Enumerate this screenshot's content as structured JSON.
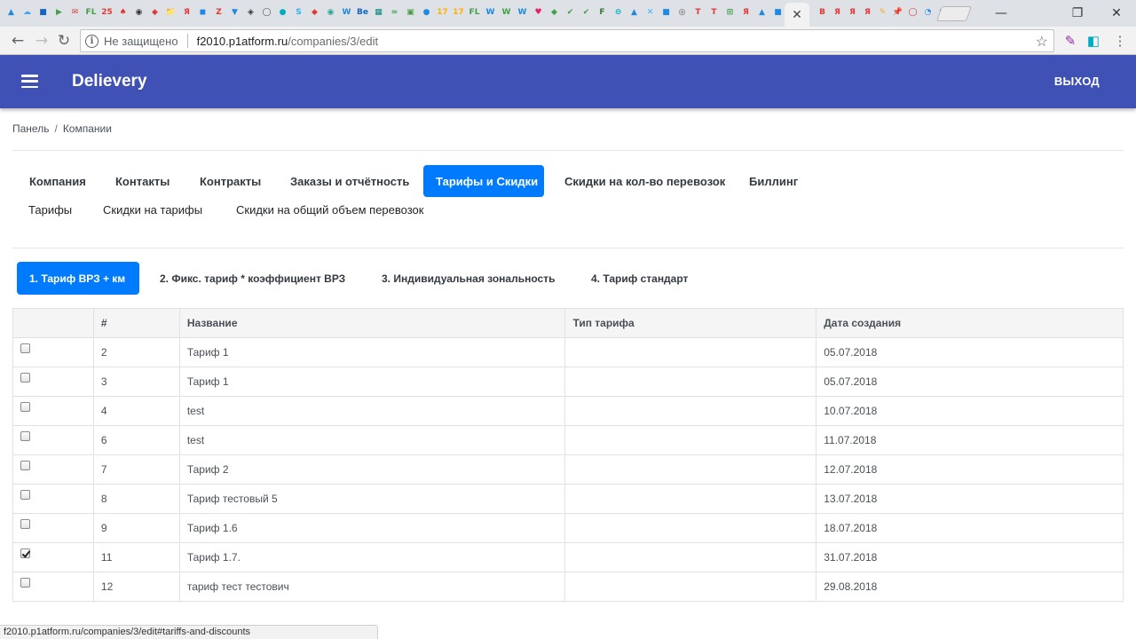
{
  "browser": {
    "tab_icons": [
      {
        "glyph": "▲",
        "color": "#1e88e5"
      },
      {
        "glyph": "☁",
        "color": "#42a5f5"
      },
      {
        "glyph": "■",
        "color": "#1565c0"
      },
      {
        "glyph": "▶",
        "color": "#43a047"
      },
      {
        "glyph": "✉",
        "color": "#e53935"
      },
      {
        "glyph": "FL",
        "color": "#43a047"
      },
      {
        "glyph": "25",
        "color": "#e53935"
      },
      {
        "glyph": "♠",
        "color": "#e53935"
      },
      {
        "glyph": "◉",
        "color": "#333333"
      },
      {
        "glyph": "◆",
        "color": "#e53935"
      },
      {
        "glyph": "📁",
        "color": "#f9a825"
      },
      {
        "glyph": "Я",
        "color": "#e53935"
      },
      {
        "glyph": "◼",
        "color": "#1e88e5"
      },
      {
        "glyph": "Z",
        "color": "#e53935"
      },
      {
        "glyph": "▼",
        "color": "#1e88e5"
      },
      {
        "glyph": "◈",
        "color": "#333333"
      },
      {
        "glyph": "◯",
        "color": "#555555"
      },
      {
        "glyph": "●",
        "color": "#00acc1"
      },
      {
        "glyph": "S",
        "color": "#29b6f6"
      },
      {
        "glyph": "◆",
        "color": "#e53935"
      },
      {
        "glyph": "◉",
        "color": "#26a69a"
      },
      {
        "glyph": "W",
        "color": "#1e88e5"
      },
      {
        "glyph": "Be",
        "color": "#1565c0"
      },
      {
        "glyph": "▦",
        "color": "#00897b"
      },
      {
        "glyph": "∞",
        "color": "#43a047"
      },
      {
        "glyph": "▣",
        "color": "#43a047"
      },
      {
        "glyph": "●",
        "color": "#1e88e5"
      },
      {
        "glyph": "17",
        "color": "#ffb300"
      },
      {
        "glyph": "17",
        "color": "#ffb300"
      },
      {
        "glyph": "FL",
        "color": "#43a047"
      },
      {
        "glyph": "W",
        "color": "#1e88e5"
      },
      {
        "glyph": "W",
        "color": "#43a047"
      },
      {
        "glyph": "W",
        "color": "#1e88e5"
      },
      {
        "glyph": "♥",
        "color": "#e91e63"
      },
      {
        "glyph": "◆",
        "color": "#43a047"
      },
      {
        "glyph": "✔",
        "color": "#43a047"
      },
      {
        "glyph": "✔",
        "color": "#43a047"
      },
      {
        "glyph": "F",
        "color": "#2e7d32"
      },
      {
        "glyph": "⊖",
        "color": "#00acc1"
      },
      {
        "glyph": "▲",
        "color": "#1e88e5"
      },
      {
        "glyph": "✕",
        "color": "#29b6f6"
      },
      {
        "glyph": "■",
        "color": "#1e88e5"
      },
      {
        "glyph": "◎",
        "color": "#555555"
      },
      {
        "glyph": "T",
        "color": "#e53935"
      },
      {
        "glyph": "T",
        "color": "#e53935"
      },
      {
        "glyph": "⊞",
        "color": "#43a047"
      },
      {
        "glyph": "Я",
        "color": "#e53935"
      },
      {
        "glyph": "▲",
        "color": "#1e88e5"
      },
      {
        "glyph": "■",
        "color": "#1e88e5"
      },
      {
        "glyph": "◎",
        "color": "#555555"
      }
    ],
    "tab_icons_right": [
      {
        "glyph": "B",
        "color": "#e53935"
      },
      {
        "glyph": "Я",
        "color": "#e53935"
      },
      {
        "glyph": "Я",
        "color": "#e53935"
      },
      {
        "glyph": "Я",
        "color": "#e53935"
      },
      {
        "glyph": "✎",
        "color": "#f9a825"
      },
      {
        "glyph": "📌",
        "color": "#e53935"
      },
      {
        "glyph": "◯",
        "color": "#e53935"
      },
      {
        "glyph": "◔",
        "color": "#1e88e5"
      },
      {
        "glyph": "■",
        "color": "#1e88e5"
      }
    ],
    "active_tab_close": "✕",
    "window_controls": {
      "minimize": "—",
      "restore": "❐",
      "close": "✕"
    },
    "back": "←",
    "forward": "→",
    "reload": "↻",
    "security_label": "Не защищено",
    "url_host": "f2010.p1atform.ru",
    "url_path": "/companies/3/edit",
    "bookmark_icon": "☆",
    "status_url": "f2010.p1atform.ru/companies/3/edit#tariffs-and-discounts"
  },
  "app": {
    "brand": "Delievery",
    "logout": "ВЫХОД",
    "header_color": "#3f51b5",
    "accent": "#007bff"
  },
  "breadcrumbs": [
    "Панель",
    "Компании"
  ],
  "main_tabs": [
    {
      "label": "Компания",
      "active": false
    },
    {
      "label": "Контакты",
      "active": false
    },
    {
      "label": "Контракты",
      "active": false
    },
    {
      "label": "Заказы и отчётность",
      "active": false
    },
    {
      "label": "Тарифы и Скидки",
      "active": true
    },
    {
      "label": "Скидки на кол-во перевозок",
      "active": false
    },
    {
      "label": "Биллинг",
      "active": false
    }
  ],
  "sub_tabs": [
    "Тарифы",
    "Скидки на тарифы",
    "Скидки на общий объем перевозок"
  ],
  "tariff_tabs": [
    {
      "label": "1. Тариф ВРЗ + км",
      "active": true
    },
    {
      "label": "2. Фикс. тариф * коэффициент ВРЗ",
      "active": false
    },
    {
      "label": "3. Индивидуальная зональность",
      "active": false
    },
    {
      "label": "4. Тариф стандарт",
      "active": false
    }
  ],
  "table": {
    "columns": [
      "",
      "#",
      "Название",
      "Тип тарифа",
      "Дата создания"
    ],
    "rows": [
      {
        "checked": false,
        "id": "2",
        "name": "Тариф 1",
        "type": "",
        "date": "05.07.2018"
      },
      {
        "checked": false,
        "id": "3",
        "name": "Тариф 1",
        "type": "",
        "date": "05.07.2018"
      },
      {
        "checked": false,
        "id": "4",
        "name": "test",
        "type": "",
        "date": "10.07.2018"
      },
      {
        "checked": false,
        "id": "6",
        "name": "test",
        "type": "",
        "date": "11.07.2018"
      },
      {
        "checked": false,
        "id": "7",
        "name": "Тариф 2",
        "type": "",
        "date": "12.07.2018"
      },
      {
        "checked": false,
        "id": "8",
        "name": "Тариф тестовый 5",
        "type": "",
        "date": "13.07.2018"
      },
      {
        "checked": false,
        "id": "9",
        "name": "Тариф 1.6",
        "type": "",
        "date": "18.07.2018"
      },
      {
        "checked": true,
        "id": "11",
        "name": "Тариф 1.7.",
        "type": "",
        "date": "31.07.2018"
      },
      {
        "checked": false,
        "id": "12",
        "name": "тариф тест тестович",
        "type": "",
        "date": "29.08.2018"
      }
    ]
  }
}
